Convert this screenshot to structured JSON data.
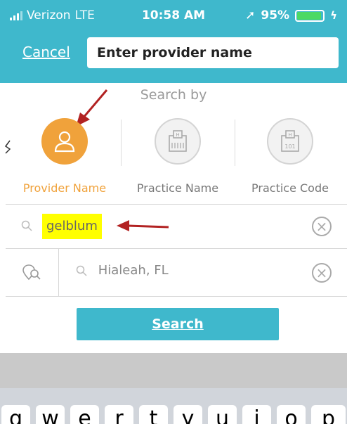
{
  "status_bar": {
    "carrier": "Verizon",
    "network": "LTE",
    "time": "10:58 AM",
    "battery": "95%"
  },
  "header": {
    "cancel_label": "Cancel",
    "provider_placeholder": "Enter provider name"
  },
  "search_by": {
    "label": "Search by",
    "options": [
      {
        "label": "Provider Name",
        "icon": "person-icon",
        "active": true
      },
      {
        "label": "Practice Name",
        "icon": "building-icon",
        "active": false
      },
      {
        "label": "Practice Code",
        "icon": "building-code-icon",
        "active": false
      }
    ]
  },
  "fields": {
    "provider_term": "gelblum",
    "location": "Hialeah, FL"
  },
  "search_button": "Search",
  "keyboard": {
    "keys": [
      "q",
      "w",
      "e",
      "r",
      "t",
      "y",
      "u",
      "i",
      "o",
      "p"
    ]
  },
  "colors": {
    "teal": "#3fb8cc",
    "orange": "#f0a23b",
    "highlight": "#ffff00",
    "arrow": "#b22222"
  }
}
